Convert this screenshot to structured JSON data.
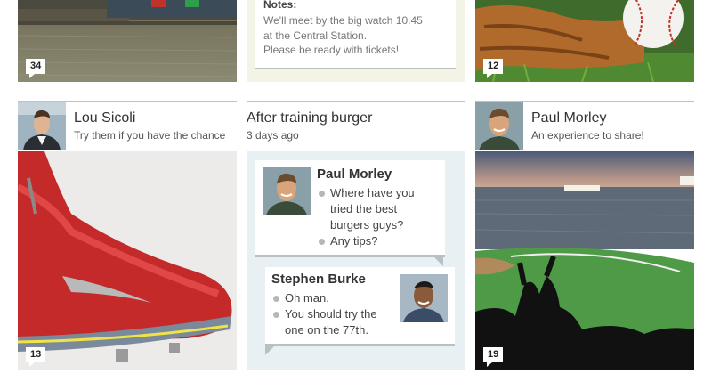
{
  "top_row": {
    "left_card": {
      "comment_count": "34"
    },
    "notes_card": {
      "heading": "Notes:",
      "lines": [
        "We'll meet by the big watch 10.45",
        "at the Central Station.",
        "Please be ready with tickets!"
      ]
    },
    "right_card": {
      "comment_count": "12"
    }
  },
  "posts": [
    {
      "author": "Lou Sicoli",
      "subtitle": "Try them if you have the chance",
      "comment_count": "13"
    },
    {
      "title": "After training burger",
      "time_ago": "3 days ago",
      "messages": [
        {
          "author": "Paul Morley",
          "items": [
            "Where have you tried the best burgers guys?",
            "Any tips?"
          ]
        },
        {
          "author": "Stephen Burke",
          "items": [
            "Oh man.",
            "You should try the one on the 77th."
          ]
        }
      ]
    },
    {
      "author": "Paul Morley",
      "subtitle": "An experience to share!",
      "comment_count": "19"
    }
  ]
}
